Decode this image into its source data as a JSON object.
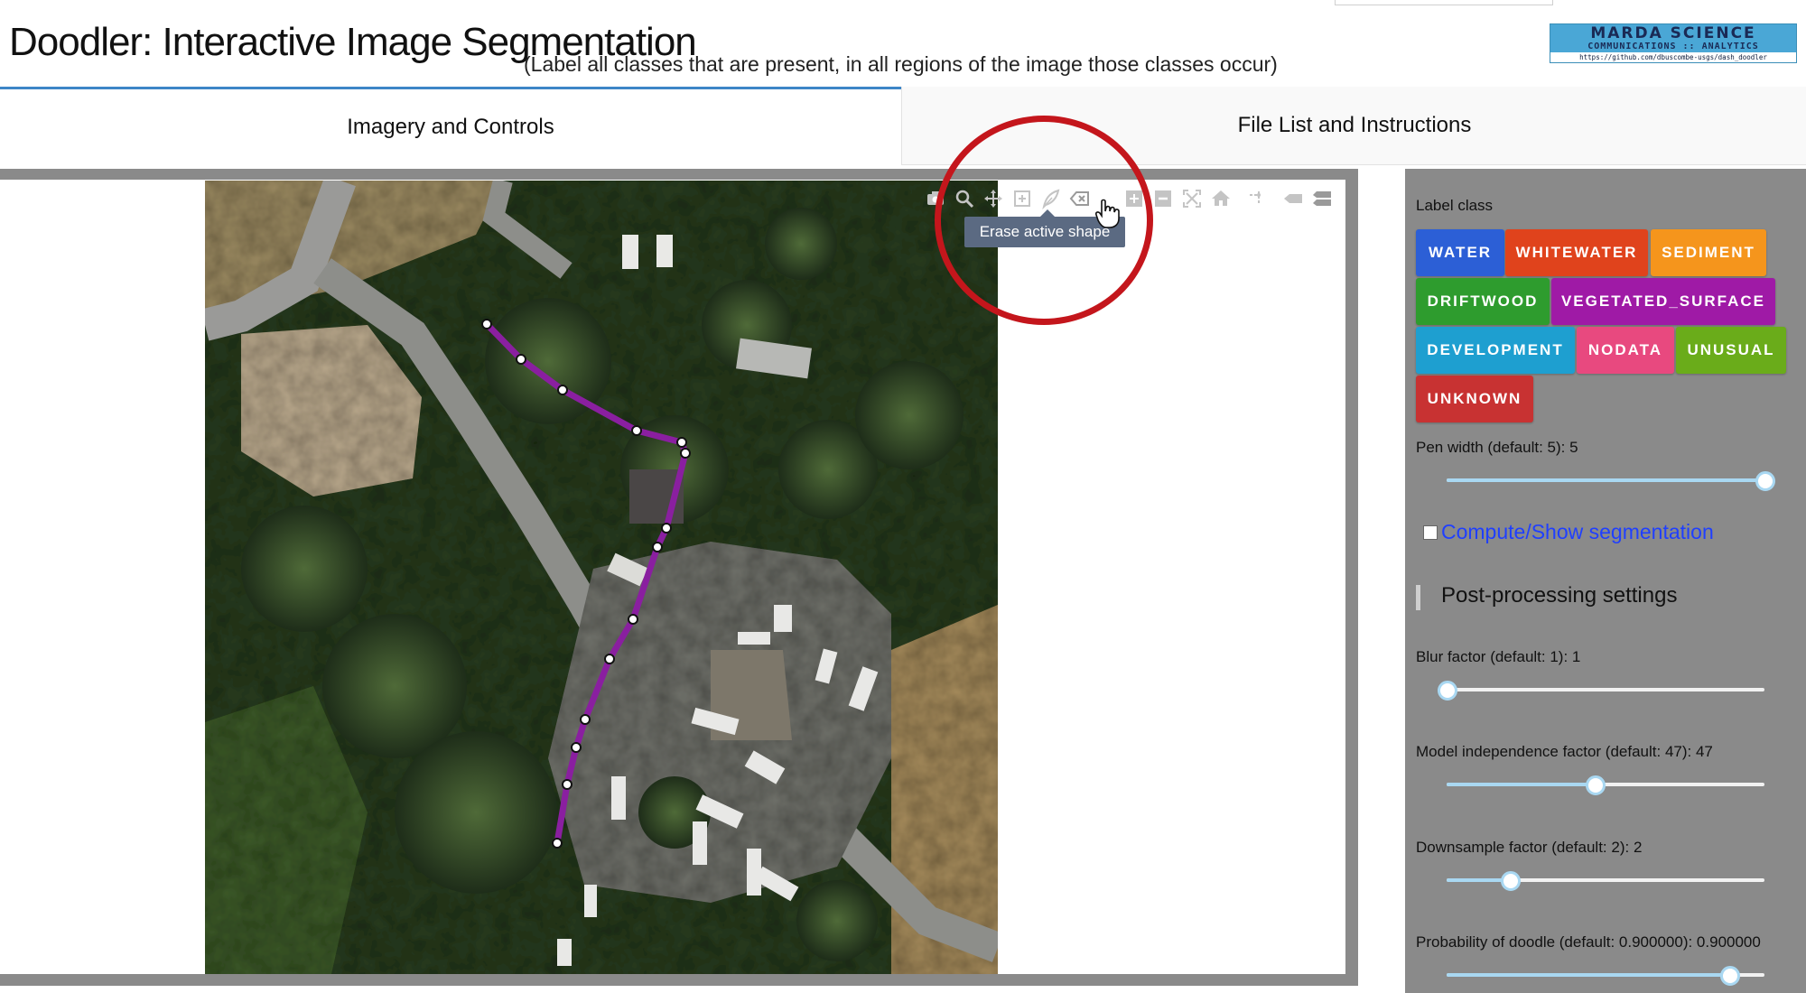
{
  "header": {
    "title": "Doodler: Interactive Image Segmentation",
    "subtitle": "(Label all classes that are present, in all regions of the image those classes occur)",
    "logo": {
      "line1": "MARDA SCIENCE",
      "line2": "COMMUNICATIONS :: ANALYTICS",
      "line3": "https://github.com/dbuscombe-usgs/dash_doodler"
    }
  },
  "tabs": [
    {
      "label": "Imagery and Controls",
      "selected": true
    },
    {
      "label": "File List and Instructions",
      "selected": false
    }
  ],
  "modebar": {
    "tooltip": "Erase active shape",
    "icons": [
      "camera-icon",
      "zoom-icon",
      "pan-icon",
      "box-select-icon",
      "draw-path-icon",
      "erase-shape-icon",
      "zoom-in-icon",
      "zoom-out-icon",
      "autoscale-icon",
      "home-icon",
      "spike-lines-icon",
      "hover-closest-icon",
      "hover-compare-icon"
    ]
  },
  "panel": {
    "label_class_title": "Label class",
    "classes": [
      {
        "label": "WATER",
        "color": "#2c5fd6"
      },
      {
        "label": "WHITEWATER",
        "color": "#e0431c"
      },
      {
        "label": "SEDIMENT",
        "color": "#f5951c"
      },
      {
        "label": "DRIFTWOOD",
        "color": "#2e9c2e"
      },
      {
        "label": "VEGETATED_SURFACE",
        "color": "#9f1aa6"
      },
      {
        "label": "DEVELOPMENT",
        "color": "#1e9fd0"
      },
      {
        "label": "NODATA",
        "color": "#e8497f"
      },
      {
        "label": "UNUSUAL",
        "color": "#6aac1a"
      },
      {
        "label": "UNKNOWN",
        "color": "#c83232"
      }
    ],
    "pen_width_label": "Pen width (default: 5): 5",
    "pen_width_fraction": 1.0,
    "compute_label": "Compute/Show segmentation",
    "postprocessing_title": "Post-processing settings",
    "blur_label": "Blur factor (default: 1): 1",
    "blur_fraction": 0.0,
    "model_label": "Model independence factor (default: 47): 47",
    "model_fraction": 0.465,
    "downsample_label": "Downsample factor (default: 2): 2",
    "downsample_fraction": 0.2,
    "probability_label": "Probability of doodle (default: 0.900000): 0.900000",
    "probability_fraction": 0.89
  }
}
